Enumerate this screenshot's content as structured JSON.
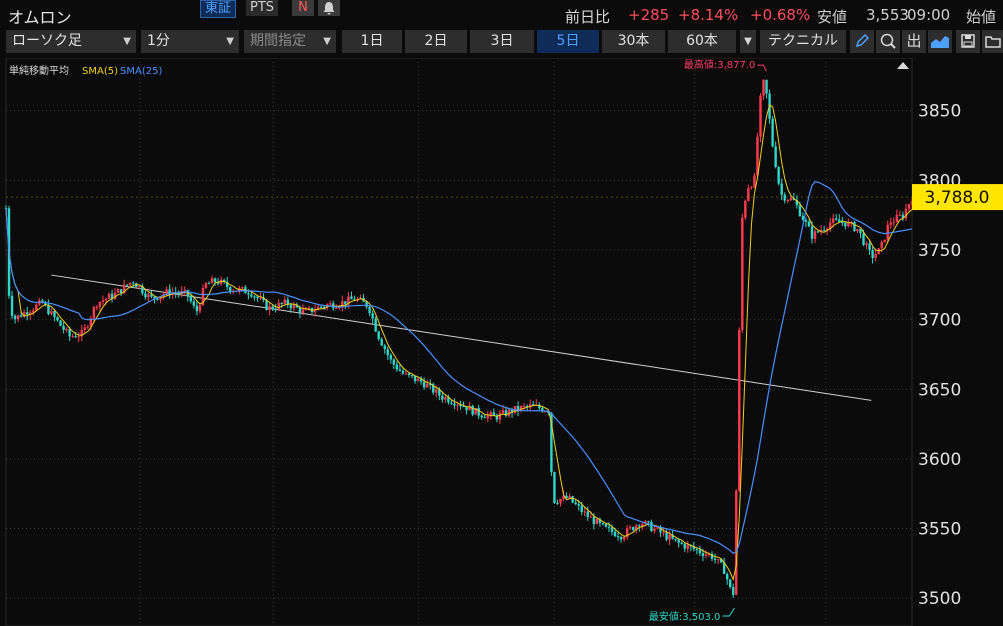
{
  "header": {
    "title": "オムロン",
    "exchange_active": "東証",
    "exchange_other": "PTS",
    "n_icon": "N",
    "bell_icon": "bell-icon",
    "quote": {
      "change_label": "前日比",
      "change_value": "+285",
      "change_pct": "+8.14%",
      "change_pct2": "+0.68%",
      "low_label": "安値",
      "low_value": "3,553",
      "time": "09:00",
      "open_label": "始値"
    }
  },
  "toolbar": {
    "chart_type": "ローソク足",
    "interval": "1分",
    "range": "期間指定",
    "periods": [
      "1日",
      "2日",
      "3日",
      "5日",
      "30本",
      "60本"
    ],
    "active_period": "5日",
    "technical": "テクニカル",
    "icons": [
      "pencil-icon",
      "zoom-icon",
      "output-icon",
      "area-chart-icon",
      "save-icon",
      "folder-icon"
    ],
    "output_label": "出"
  },
  "colors": {
    "background": "#0b0b0b",
    "up": "#ff3b4e",
    "down": "#30d6c8",
    "sma5": "#f0d020",
    "sma25": "#4a90ff",
    "price_badge": "#ffe600",
    "high_label": "#ff3b6b",
    "low_label": "#30d6c8"
  },
  "chart_data": {
    "type": "candlestick",
    "indicator_title": "単純移動平均",
    "legend": [
      "SMA(5)",
      "SMA(25)"
    ],
    "x_ticks_visible": false,
    "ylim": [
      3480,
      3885
    ],
    "y_ticks": [
      3500,
      3550,
      3600,
      3650,
      3700,
      3750,
      3800,
      3850
    ],
    "current_price": 3788.0,
    "current_price_label": "3,788.0",
    "high": {
      "value": 3877.0,
      "label": "最高値:3,877.0"
    },
    "low": {
      "value": 3503.0,
      "label": "最安値:3,503.0"
    },
    "trendline": {
      "from": [
        0.05,
        3732
      ],
      "to": [
        0.955,
        3642
      ]
    },
    "grid": true,
    "price_path": [
      [
        0.0,
        3780
      ],
      [
        0.003,
        3720
      ],
      [
        0.008,
        3700
      ],
      [
        0.02,
        3705
      ],
      [
        0.04,
        3712
      ],
      [
        0.055,
        3700
      ],
      [
        0.07,
        3688
      ],
      [
        0.085,
        3690
      ],
      [
        0.1,
        3712
      ],
      [
        0.12,
        3718
      ],
      [
        0.14,
        3728
      ],
      [
        0.16,
        3715
      ],
      [
        0.18,
        3720
      ],
      [
        0.2,
        3718
      ],
      [
        0.21,
        3705
      ],
      [
        0.22,
        3725
      ],
      [
        0.232,
        3728
      ],
      [
        0.25,
        3722
      ],
      [
        0.27,
        3720
      ],
      [
        0.29,
        3708
      ],
      [
        0.31,
        3712
      ],
      [
        0.33,
        3705
      ],
      [
        0.35,
        3710
      ],
      [
        0.37,
        3712
      ],
      [
        0.385,
        3715
      ],
      [
        0.4,
        3710
      ],
      [
        0.41,
        3690
      ],
      [
        0.425,
        3670
      ],
      [
        0.44,
        3660
      ],
      [
        0.46,
        3655
      ],
      [
        0.48,
        3645
      ],
      [
        0.5,
        3640
      ],
      [
        0.52,
        3633
      ],
      [
        0.54,
        3630
      ],
      [
        0.56,
        3635
      ],
      [
        0.58,
        3638
      ],
      [
        0.6,
        3635
      ],
      [
        0.603,
        3570
      ],
      [
        0.62,
        3572
      ],
      [
        0.64,
        3560
      ],
      [
        0.66,
        3550
      ],
      [
        0.68,
        3545
      ],
      [
        0.7,
        3555
      ],
      [
        0.72,
        3548
      ],
      [
        0.74,
        3540
      ],
      [
        0.76,
        3535
      ],
      [
        0.78,
        3530
      ],
      [
        0.793,
        3520
      ],
      [
        0.8,
        3505
      ],
      [
        0.804,
        3503
      ],
      [
        0.808,
        3650
      ],
      [
        0.812,
        3770
      ],
      [
        0.818,
        3795
      ],
      [
        0.826,
        3800
      ],
      [
        0.832,
        3855
      ],
      [
        0.836,
        3870
      ],
      [
        0.84,
        3860
      ],
      [
        0.845,
        3830
      ],
      [
        0.855,
        3790
      ],
      [
        0.87,
        3785
      ],
      [
        0.89,
        3760
      ],
      [
        0.91,
        3770
      ],
      [
        0.925,
        3770
      ],
      [
        0.94,
        3765
      ],
      [
        0.955,
        3745
      ],
      [
        0.965,
        3750
      ],
      [
        0.975,
        3770
      ],
      [
        0.99,
        3775
      ],
      [
        1.0,
        3788
      ]
    ]
  }
}
